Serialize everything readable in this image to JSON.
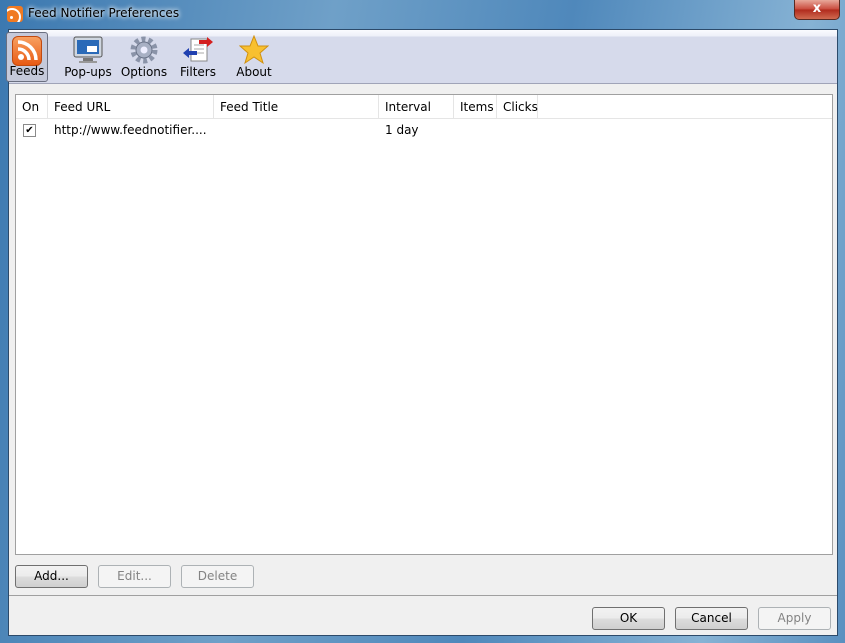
{
  "window": {
    "title": "Feed Notifier Preferences",
    "close_label": "x"
  },
  "toolbar": [
    {
      "label": "Feeds",
      "icon": "rss-icon",
      "active": true
    },
    {
      "label": "Pop-ups",
      "icon": "monitor-icon"
    },
    {
      "label": "Options",
      "icon": "gear-icon"
    },
    {
      "label": "Filters",
      "icon": "filter-arrows-icon"
    },
    {
      "label": "About",
      "icon": "star-icon"
    }
  ],
  "list": {
    "columns": [
      "On",
      "Feed URL",
      "Feed Title",
      "Interval",
      "Items",
      "Clicks"
    ],
    "rows": [
      {
        "on": true,
        "checkmark": "✔",
        "url": "http://www.feednotifier....",
        "title": "",
        "interval": "1 day",
        "items": "",
        "clicks": ""
      }
    ]
  },
  "buttons": {
    "add": "Add...",
    "edit": "Edit...",
    "delete": "Delete",
    "ok": "OK",
    "cancel": "Cancel",
    "apply": "Apply"
  },
  "colors": {
    "rss": "#f07a22",
    "close": "#c8473a",
    "toolbar_bg": "#d6daeb"
  }
}
